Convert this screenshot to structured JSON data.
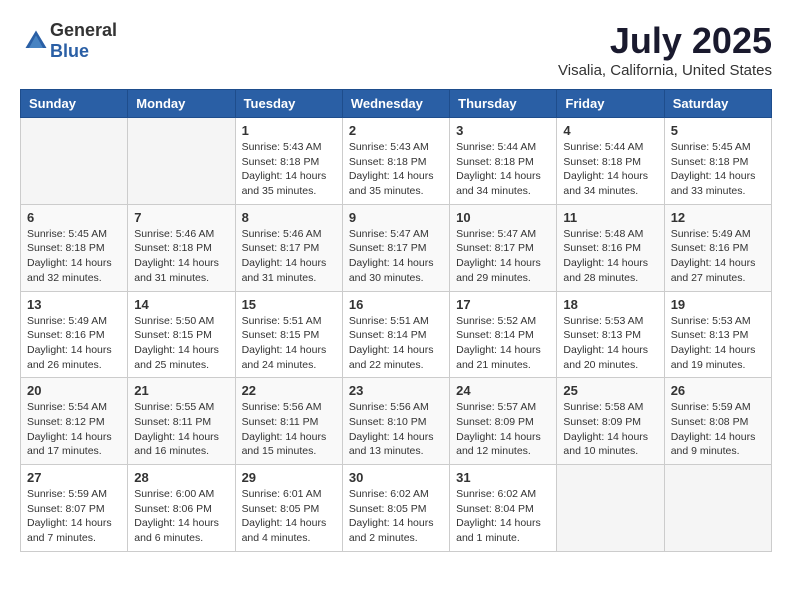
{
  "logo": {
    "general": "General",
    "blue": "Blue"
  },
  "title": "July 2025",
  "location": "Visalia, California, United States",
  "weekdays": [
    "Sunday",
    "Monday",
    "Tuesday",
    "Wednesday",
    "Thursday",
    "Friday",
    "Saturday"
  ],
  "weeks": [
    [
      {
        "day": "",
        "sunrise": "",
        "sunset": "",
        "daylight": ""
      },
      {
        "day": "",
        "sunrise": "",
        "sunset": "",
        "daylight": ""
      },
      {
        "day": "1",
        "sunrise": "Sunrise: 5:43 AM",
        "sunset": "Sunset: 8:18 PM",
        "daylight": "Daylight: 14 hours and 35 minutes."
      },
      {
        "day": "2",
        "sunrise": "Sunrise: 5:43 AM",
        "sunset": "Sunset: 8:18 PM",
        "daylight": "Daylight: 14 hours and 35 minutes."
      },
      {
        "day": "3",
        "sunrise": "Sunrise: 5:44 AM",
        "sunset": "Sunset: 8:18 PM",
        "daylight": "Daylight: 14 hours and 34 minutes."
      },
      {
        "day": "4",
        "sunrise": "Sunrise: 5:44 AM",
        "sunset": "Sunset: 8:18 PM",
        "daylight": "Daylight: 14 hours and 34 minutes."
      },
      {
        "day": "5",
        "sunrise": "Sunrise: 5:45 AM",
        "sunset": "Sunset: 8:18 PM",
        "daylight": "Daylight: 14 hours and 33 minutes."
      }
    ],
    [
      {
        "day": "6",
        "sunrise": "Sunrise: 5:45 AM",
        "sunset": "Sunset: 8:18 PM",
        "daylight": "Daylight: 14 hours and 32 minutes."
      },
      {
        "day": "7",
        "sunrise": "Sunrise: 5:46 AM",
        "sunset": "Sunset: 8:18 PM",
        "daylight": "Daylight: 14 hours and 31 minutes."
      },
      {
        "day": "8",
        "sunrise": "Sunrise: 5:46 AM",
        "sunset": "Sunset: 8:17 PM",
        "daylight": "Daylight: 14 hours and 31 minutes."
      },
      {
        "day": "9",
        "sunrise": "Sunrise: 5:47 AM",
        "sunset": "Sunset: 8:17 PM",
        "daylight": "Daylight: 14 hours and 30 minutes."
      },
      {
        "day": "10",
        "sunrise": "Sunrise: 5:47 AM",
        "sunset": "Sunset: 8:17 PM",
        "daylight": "Daylight: 14 hours and 29 minutes."
      },
      {
        "day": "11",
        "sunrise": "Sunrise: 5:48 AM",
        "sunset": "Sunset: 8:16 PM",
        "daylight": "Daylight: 14 hours and 28 minutes."
      },
      {
        "day": "12",
        "sunrise": "Sunrise: 5:49 AM",
        "sunset": "Sunset: 8:16 PM",
        "daylight": "Daylight: 14 hours and 27 minutes."
      }
    ],
    [
      {
        "day": "13",
        "sunrise": "Sunrise: 5:49 AM",
        "sunset": "Sunset: 8:16 PM",
        "daylight": "Daylight: 14 hours and 26 minutes."
      },
      {
        "day": "14",
        "sunrise": "Sunrise: 5:50 AM",
        "sunset": "Sunset: 8:15 PM",
        "daylight": "Daylight: 14 hours and 25 minutes."
      },
      {
        "day": "15",
        "sunrise": "Sunrise: 5:51 AM",
        "sunset": "Sunset: 8:15 PM",
        "daylight": "Daylight: 14 hours and 24 minutes."
      },
      {
        "day": "16",
        "sunrise": "Sunrise: 5:51 AM",
        "sunset": "Sunset: 8:14 PM",
        "daylight": "Daylight: 14 hours and 22 minutes."
      },
      {
        "day": "17",
        "sunrise": "Sunrise: 5:52 AM",
        "sunset": "Sunset: 8:14 PM",
        "daylight": "Daylight: 14 hours and 21 minutes."
      },
      {
        "day": "18",
        "sunrise": "Sunrise: 5:53 AM",
        "sunset": "Sunset: 8:13 PM",
        "daylight": "Daylight: 14 hours and 20 minutes."
      },
      {
        "day": "19",
        "sunrise": "Sunrise: 5:53 AM",
        "sunset": "Sunset: 8:13 PM",
        "daylight": "Daylight: 14 hours and 19 minutes."
      }
    ],
    [
      {
        "day": "20",
        "sunrise": "Sunrise: 5:54 AM",
        "sunset": "Sunset: 8:12 PM",
        "daylight": "Daylight: 14 hours and 17 minutes."
      },
      {
        "day": "21",
        "sunrise": "Sunrise: 5:55 AM",
        "sunset": "Sunset: 8:11 PM",
        "daylight": "Daylight: 14 hours and 16 minutes."
      },
      {
        "day": "22",
        "sunrise": "Sunrise: 5:56 AM",
        "sunset": "Sunset: 8:11 PM",
        "daylight": "Daylight: 14 hours and 15 minutes."
      },
      {
        "day": "23",
        "sunrise": "Sunrise: 5:56 AM",
        "sunset": "Sunset: 8:10 PM",
        "daylight": "Daylight: 14 hours and 13 minutes."
      },
      {
        "day": "24",
        "sunrise": "Sunrise: 5:57 AM",
        "sunset": "Sunset: 8:09 PM",
        "daylight": "Daylight: 14 hours and 12 minutes."
      },
      {
        "day": "25",
        "sunrise": "Sunrise: 5:58 AM",
        "sunset": "Sunset: 8:09 PM",
        "daylight": "Daylight: 14 hours and 10 minutes."
      },
      {
        "day": "26",
        "sunrise": "Sunrise: 5:59 AM",
        "sunset": "Sunset: 8:08 PM",
        "daylight": "Daylight: 14 hours and 9 minutes."
      }
    ],
    [
      {
        "day": "27",
        "sunrise": "Sunrise: 5:59 AM",
        "sunset": "Sunset: 8:07 PM",
        "daylight": "Daylight: 14 hours and 7 minutes."
      },
      {
        "day": "28",
        "sunrise": "Sunrise: 6:00 AM",
        "sunset": "Sunset: 8:06 PM",
        "daylight": "Daylight: 14 hours and 6 minutes."
      },
      {
        "day": "29",
        "sunrise": "Sunrise: 6:01 AM",
        "sunset": "Sunset: 8:05 PM",
        "daylight": "Daylight: 14 hours and 4 minutes."
      },
      {
        "day": "30",
        "sunrise": "Sunrise: 6:02 AM",
        "sunset": "Sunset: 8:05 PM",
        "daylight": "Daylight: 14 hours and 2 minutes."
      },
      {
        "day": "31",
        "sunrise": "Sunrise: 6:02 AM",
        "sunset": "Sunset: 8:04 PM",
        "daylight": "Daylight: 14 hours and 1 minute."
      },
      {
        "day": "",
        "sunrise": "",
        "sunset": "",
        "daylight": ""
      },
      {
        "day": "",
        "sunrise": "",
        "sunset": "",
        "daylight": ""
      }
    ]
  ]
}
